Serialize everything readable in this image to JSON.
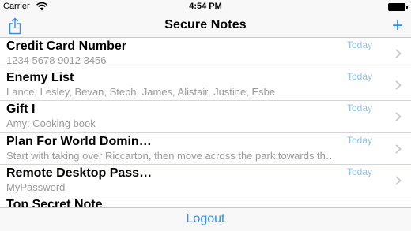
{
  "status": {
    "carrier": "Carrier",
    "time": "4:54 PM"
  },
  "nav": {
    "title": "Secure Notes",
    "add_label": "+"
  },
  "notes": [
    {
      "title": "Credit Card Number",
      "subtitle": "1234 5678 9012 3456",
      "date": "Today"
    },
    {
      "title": "Enemy List",
      "subtitle": "Lance, Lesley, Bevan, Steph, James, Alistair, Justine, Esbe",
      "date": "Today"
    },
    {
      "title": "Gift I",
      "subtitle": "Amy: Cooking book",
      "date": "Today"
    },
    {
      "title": "Plan For World Domin…",
      "subtitle": "Start with taking over Riccarton, then move across the park towards th…",
      "date": "Today"
    },
    {
      "title": "Remote Desktop Pass…",
      "subtitle": "MyPassword",
      "date": "Today"
    },
    {
      "title": "Top Secret Note",
      "subtitle": "",
      "date": ""
    }
  ],
  "toolbar": {
    "logout_label": "Logout"
  },
  "colors": {
    "accent": "#2f8ff3",
    "date": "#8fc0ee",
    "subtitle": "#9a9a9a"
  },
  "icons": {
    "share": "share-icon",
    "chevron": "chevron-right-icon",
    "wifi": "wifi-icon",
    "battery": "battery-icon"
  }
}
